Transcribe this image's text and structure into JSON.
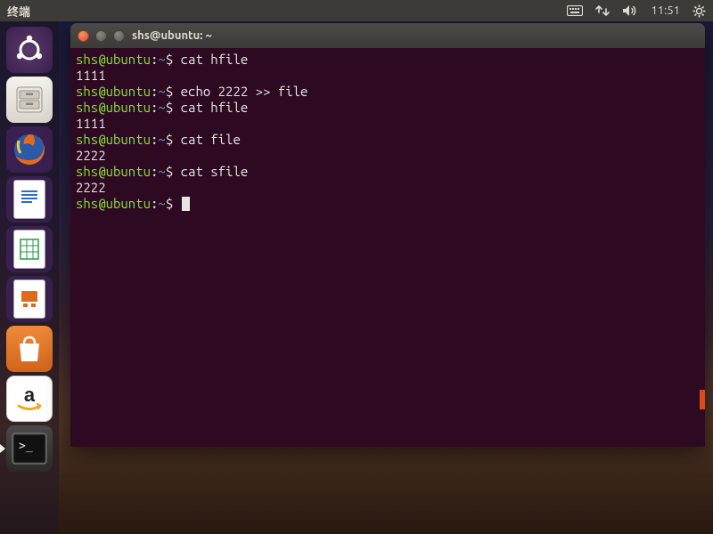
{
  "top_panel": {
    "active_app": "终端",
    "time": "11:51",
    "indicators": {
      "keyboard": "keyboard-icon",
      "network": "network-updown-icon",
      "sound": "volume-high-icon",
      "gear": "system-gear-icon"
    }
  },
  "launcher": {
    "items": [
      {
        "name": "ubuntu-dash",
        "label": "Dash"
      },
      {
        "name": "files",
        "label": "Files"
      },
      {
        "name": "firefox",
        "label": "Firefox"
      },
      {
        "name": "libreoffice-writer",
        "label": "LibreOffice Writer"
      },
      {
        "name": "libreoffice-calc",
        "label": "LibreOffice Calc"
      },
      {
        "name": "libreoffice-impress",
        "label": "LibreOffice Impress"
      },
      {
        "name": "ubuntu-software",
        "label": "Ubuntu Software"
      },
      {
        "name": "amazon",
        "label": "Amazon"
      },
      {
        "name": "terminal",
        "label": "Terminal",
        "active": true
      }
    ]
  },
  "terminal": {
    "title": "shs@ubuntu: ~",
    "prompt": {
      "userhost": "shs@ubuntu",
      "path": "~",
      "symbol": "$"
    },
    "lines": [
      {
        "type": "cmd",
        "text": "cat hfile"
      },
      {
        "type": "out",
        "text": "1111"
      },
      {
        "type": "cmd",
        "text": "echo 2222 >> file"
      },
      {
        "type": "cmd",
        "text": "cat hfile"
      },
      {
        "type": "out",
        "text": "1111"
      },
      {
        "type": "cmd",
        "text": "cat file"
      },
      {
        "type": "out",
        "text": "2222"
      },
      {
        "type": "cmd",
        "text": "cat sfile"
      },
      {
        "type": "out",
        "text": "2222"
      },
      {
        "type": "cmd",
        "text": "",
        "cursor": true
      }
    ]
  }
}
